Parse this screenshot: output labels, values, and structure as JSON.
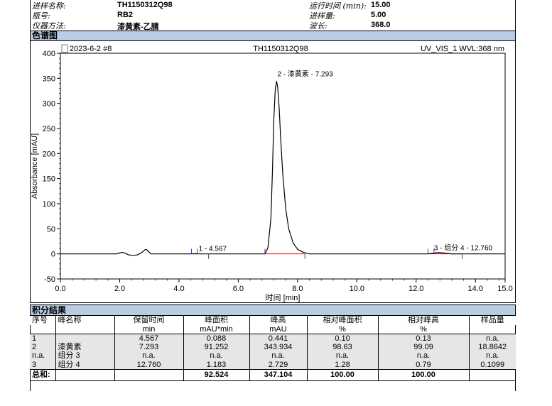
{
  "header": {
    "rows": [
      {
        "left_label": "进样名称:",
        "left_value": "TH1150312Q98",
        "right_label": "运行时间 (min):",
        "right_value": "15.00"
      },
      {
        "left_label": "瓶号:",
        "left_value": "RB2",
        "right_label": "进样量:",
        "right_value": "5.00"
      },
      {
        "left_label": "仪器方法:",
        "left_value": "漆黄素-乙腈",
        "right_label": "波长:",
        "right_value": "368.0"
      }
    ]
  },
  "chromatogram_section": {
    "title": "色谱图"
  },
  "chart_meta": {
    "left_title": "2023-6-2 #8",
    "center_title": "TH1150312Q98",
    "right_title": "UV_VIS_1 WVL:368 nm"
  },
  "chart_data": {
    "type": "line",
    "xlabel": "时间 [min]",
    "ylabel": "Absorbance [mAU]",
    "xlim": [
      0.0,
      15.0
    ],
    "ylim": [
      -50,
      400
    ],
    "xticks": [
      "0.0",
      "2.0",
      "4.0",
      "6.0",
      "8.0",
      "10.0",
      "12.0",
      "14.0",
      "15.0"
    ],
    "xtick_values": [
      0,
      2,
      4,
      6,
      8,
      10,
      12,
      14,
      15
    ],
    "yticks": [
      "-50",
      "0",
      "50",
      "100",
      "150",
      "200",
      "250",
      "300",
      "350",
      "400"
    ],
    "ytick_values": [
      -50,
      0,
      50,
      100,
      150,
      200,
      250,
      300,
      350,
      400
    ],
    "series": [
      {
        "color": "#000000",
        "x": [
          0.0,
          1.9,
          2.0,
          2.1,
          2.2,
          2.3,
          2.45,
          2.6,
          2.75,
          2.85,
          2.9,
          2.95,
          3.05,
          3.2,
          4.4,
          4.56,
          4.7,
          6.9,
          7.0,
          7.1,
          7.15,
          7.2,
          7.25,
          7.293,
          7.33,
          7.38,
          7.43,
          7.5,
          7.6,
          7.7,
          7.85,
          8.0,
          8.2,
          8.4,
          12.4,
          12.6,
          12.76,
          12.95,
          13.2,
          15.0
        ],
        "y": [
          0,
          0,
          2,
          3,
          1,
          -2,
          -3,
          -2,
          3,
          8,
          9,
          6,
          0,
          0,
          0,
          0.4,
          0,
          0,
          12,
          70,
          160,
          270,
          330,
          343.9,
          332,
          290,
          230,
          160,
          90,
          50,
          22,
          9,
          3,
          0,
          0,
          1.5,
          2.7,
          1.5,
          0,
          0
        ]
      }
    ],
    "baselines": [
      {
        "color": "#e0001b",
        "x": [
          4.42,
          4.62
        ],
        "y": [
          0,
          0
        ]
      },
      {
        "color": "#e0001b",
        "x": [
          6.9,
          8.25
        ],
        "y": [
          0,
          0
        ]
      },
      {
        "color": "#e0001b",
        "x": [
          12.4,
          13.55
        ],
        "y": [
          0,
          0
        ]
      }
    ],
    "peaks": [
      {
        "label": "1 - 4.567",
        "x": 4.567,
        "y": 0.441
      },
      {
        "label": "2 - 漆黄素 - 7.293",
        "x": 7.293,
        "y": 343.934
      },
      {
        "label": "3 - 组分 4 - 12.760",
        "x": 12.76,
        "y": 2.729
      }
    ],
    "peak_markers": [
      {
        "x": 4.42,
        "side": "up"
      },
      {
        "x": 4.62,
        "side": "up"
      },
      {
        "x": 5.0,
        "side": "down"
      },
      {
        "x": 6.9,
        "side": "up"
      },
      {
        "x": 8.25,
        "side": "down"
      },
      {
        "x": 12.4,
        "side": "up"
      },
      {
        "x": 12.6,
        "side": "up"
      },
      {
        "x": 13.55,
        "side": "down"
      }
    ]
  },
  "results_section": {
    "title": "积分结果"
  },
  "results": {
    "headers": [
      "序号",
      "峰名称",
      "保留时间",
      "峰面积",
      "峰高",
      "相对峰面积",
      "相对峰高",
      "样品量"
    ],
    "units": [
      "",
      "",
      "min",
      "mAU*min",
      "mAU",
      "%",
      "%",
      ""
    ],
    "rows": [
      [
        "1",
        "",
        "4.567",
        "0.088",
        "0.441",
        "0.10",
        "0.13",
        "n.a."
      ],
      [
        "2",
        "漆黄素",
        "7.293",
        "91.252",
        "343.934",
        "98.63",
        "99.09",
        "18.8642"
      ],
      [
        "n.a.",
        "组分 3",
        "n.a.",
        "n.a.",
        "n.a.",
        "n.a.",
        "n.a.",
        "n.a."
      ],
      [
        "3",
        "组分 4",
        "12.760",
        "1.183",
        "2.729",
        "1.28",
        "0.79",
        "0.1099"
      ]
    ],
    "total": [
      "总和:",
      "",
      "",
      "92.524",
      "347.104",
      "100.00",
      "100.00",
      ""
    ]
  }
}
